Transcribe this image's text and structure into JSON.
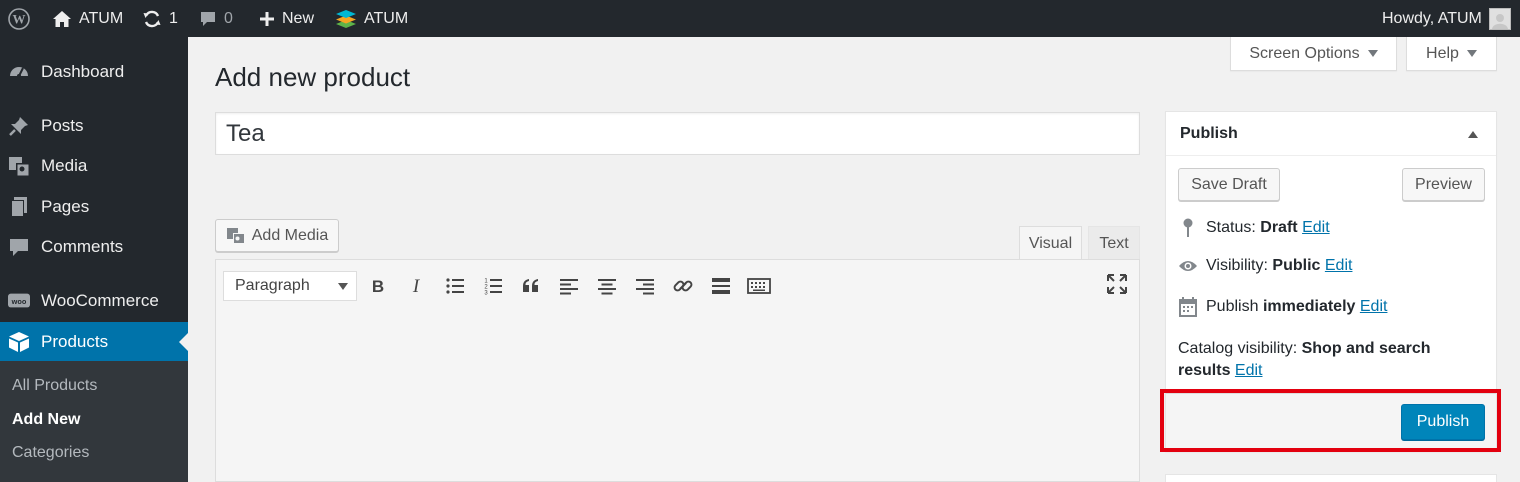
{
  "adminbar": {
    "site_name": "ATUM",
    "updates_count": "1",
    "comments_count": "0",
    "new_label": "New",
    "plugin_label": "ATUM",
    "greeting": "Howdy, ATUM"
  },
  "sidebar": {
    "items": [
      {
        "label": "Dashboard",
        "icon": "dashboard-icon"
      },
      {
        "label": "Posts",
        "icon": "pin-icon"
      },
      {
        "label": "Media",
        "icon": "media-icon"
      },
      {
        "label": "Pages",
        "icon": "pages-icon"
      },
      {
        "label": "Comments",
        "icon": "comment-icon"
      },
      {
        "label": "WooCommerce",
        "icon": "woo-icon"
      },
      {
        "label": "Products",
        "icon": "box-icon",
        "current": true
      }
    ],
    "submenu": [
      "All Products",
      "Add New",
      "Categories"
    ]
  },
  "screen_options_label": "Screen Options",
  "help_label": "Help",
  "page_title": "Add new product",
  "product_title": "Tea",
  "editor": {
    "add_media_label": "Add Media",
    "tab_visual": "Visual",
    "tab_text": "Text",
    "format_value": "Paragraph"
  },
  "publish_box": {
    "title": "Publish",
    "save_draft": "Save Draft",
    "preview": "Preview",
    "status_label": "Status:",
    "status_value": "Draft",
    "visibility_label": "Visibility:",
    "visibility_value": "Public",
    "publish_label": "Publish",
    "publish_value": "immediately",
    "catalog_label": "Catalog visibility:",
    "catalog_value": "Shop and search results",
    "edit_label": "Edit",
    "publish_button": "Publish"
  },
  "colors": {
    "adminbar_bg": "#23282d",
    "accent": "#0073aa",
    "primary_button": "#0085ba",
    "highlight": "#e3000f"
  }
}
